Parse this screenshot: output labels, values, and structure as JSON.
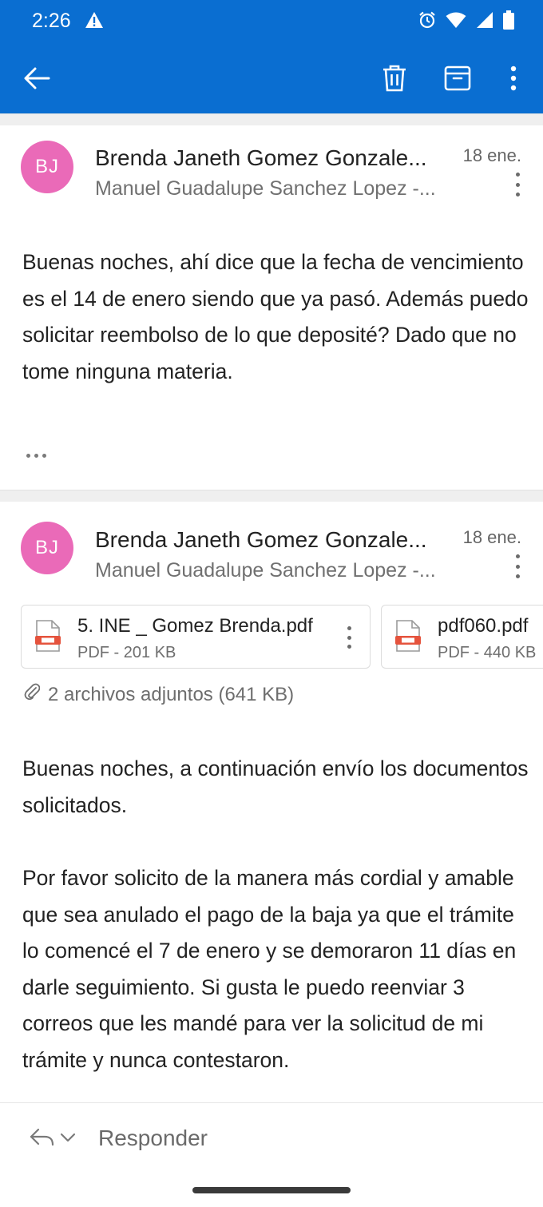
{
  "status_bar": {
    "time": "2:26",
    "icons": [
      "alert-icon",
      "alarm-icon",
      "wifi-icon",
      "signal-icon",
      "battery-icon"
    ]
  },
  "toolbar": {
    "icons": [
      "back-arrow-icon",
      "trash-icon",
      "archive-icon",
      "more-vertical-icon"
    ]
  },
  "colors": {
    "app_bar": "#0a6ed1",
    "avatar": "#ea6ab8"
  },
  "messages": [
    {
      "avatar_initials": "BJ",
      "sender": "Brenda Janeth Gomez Gonzale...",
      "recipients": "Manuel Guadalupe Sanchez Lopez -...",
      "date": "18 ene.",
      "body": "Buenas noches, ahí dice que la fecha de vencimiento es el 14 de enero siendo que ya pasó. Además puedo solicitar reembolso de lo que deposité? Dado que no tome ninguna materia."
    },
    {
      "avatar_initials": "BJ",
      "sender": "Brenda Janeth Gomez Gonzale...",
      "recipients": "Manuel Guadalupe Sanchez Lopez -...",
      "date": "18 ene.",
      "attachments": [
        {
          "name": "5. INE _ Gomez Brenda.pdf",
          "meta": "PDF - 201 KB"
        },
        {
          "name": "pdf060.pdf",
          "meta": "PDF - 440 KB"
        }
      ],
      "attachments_summary": "2 archivos adjuntos (641 KB)",
      "body_paragraph_1": "Buenas noches, a continuación envío los documentos solicitados.",
      "body_paragraph_2": "Por favor solicito de la manera más cordial y amable que sea anulado el pago de la baja ya que el trámite   lo comencé el 7 de enero y se demoraron 11 días en darle seguimiento. Si gusta le puedo reenviar 3 correos que les mandé para ver la solicitud de mi trámite y nunca contestaron."
    }
  ],
  "reply_bar": {
    "label": "Responder"
  }
}
